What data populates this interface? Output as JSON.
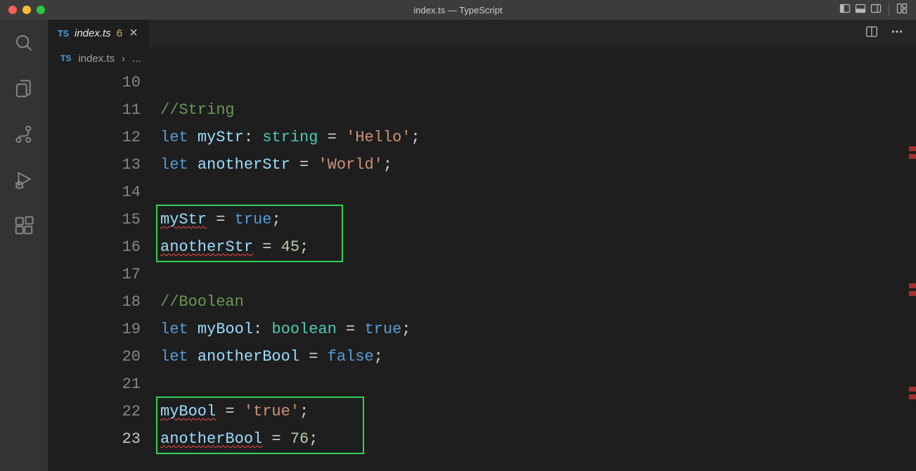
{
  "titlebar": {
    "title": "index.ts — TypeScript"
  },
  "tab": {
    "lang": "TS",
    "name": "index.ts",
    "modified_count": "6"
  },
  "breadcrumb": {
    "lang": "TS",
    "file": "index.ts",
    "chevron": "›",
    "rest": "..."
  },
  "gutter": [
    "10",
    "11",
    "12",
    "13",
    "14",
    "15",
    "16",
    "17",
    "18",
    "19",
    "20",
    "21",
    "22",
    "23"
  ],
  "code": {
    "l10": "",
    "c11_comment": "//String",
    "c12": {
      "let": "let",
      "sp": " ",
      "v": "myStr",
      "colon": ": ",
      "type": "string",
      "eq": " = ",
      "str": "'Hello'",
      "end": ";"
    },
    "c13": {
      "let": "let",
      "sp": " ",
      "v": "anotherStr",
      "eq": " = ",
      "str": "'World'",
      "end": ";"
    },
    "c15": {
      "v": "myStr",
      "eq": " = ",
      "val": "true",
      "end": ";"
    },
    "c16": {
      "v": "anotherStr",
      "eq": " = ",
      "val": "45",
      "end": ";"
    },
    "c18_comment": "//Boolean",
    "c19": {
      "let": "let",
      "sp": " ",
      "v": "myBool",
      "colon": ": ",
      "type": "boolean",
      "eq": " = ",
      "val": "true",
      "end": ";"
    },
    "c20": {
      "let": "let",
      "sp": " ",
      "v": "anotherBool",
      "eq": " = ",
      "val": "false",
      "end": ";"
    },
    "c22": {
      "v": "myBool",
      "eq": " = ",
      "str": "'true'",
      "end": ";"
    },
    "c23": {
      "v": "anotherBool",
      "eq": " = ",
      "val": "76",
      "end": ";"
    }
  }
}
